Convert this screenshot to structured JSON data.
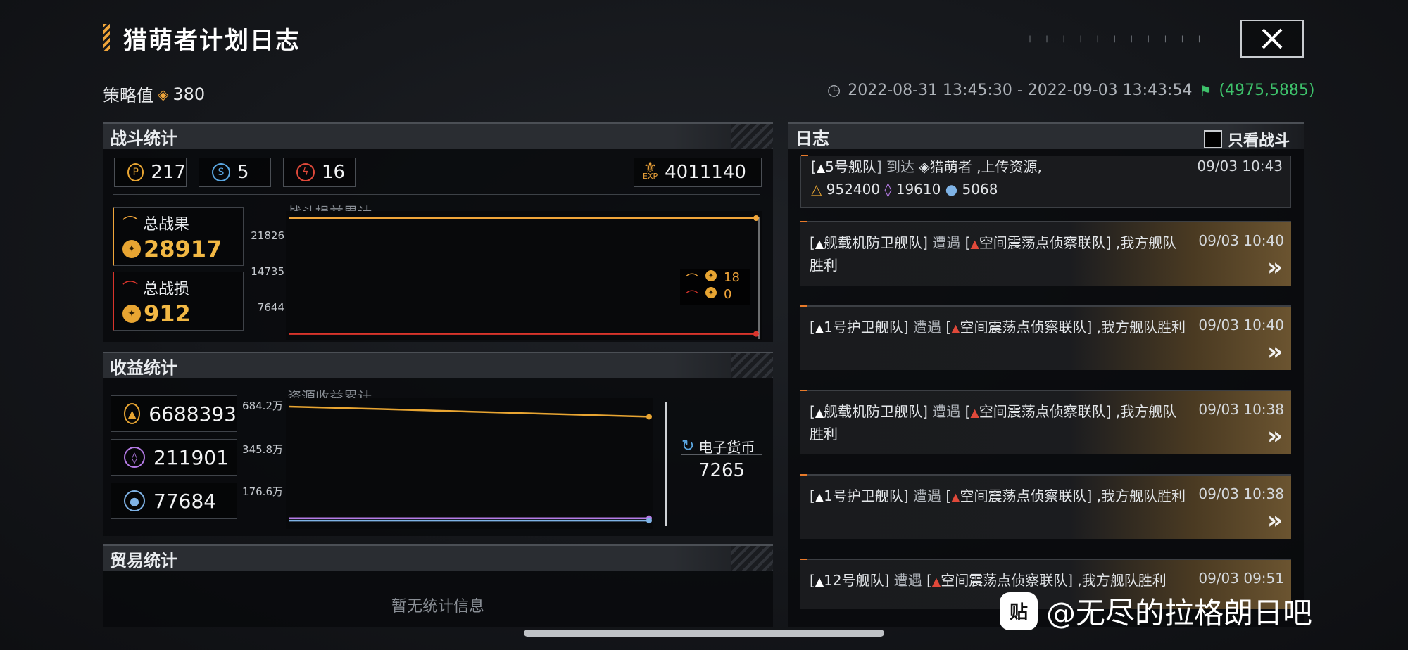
{
  "header": {
    "title": "猎萌者计划日志",
    "strategy_label": "策略值",
    "strategy_value": "380",
    "time_range": "2022-08-31 13:45:30 - 2022-09-03 13:43:54",
    "coordinates": "(4975,5885)",
    "ticks": "| | | | | |  | | | | |"
  },
  "combat": {
    "section_title": "战斗统计",
    "stats": [
      {
        "icon": "p-icon",
        "value": "217"
      },
      {
        "icon": "s-icon",
        "value": "5"
      },
      {
        "icon": "lightning-icon",
        "value": "16"
      }
    ],
    "exp_label": "EXP",
    "exp_value": "4011140",
    "total_gain_label": "总战果",
    "total_gain_value": "28917",
    "total_loss_label": "总战损",
    "total_loss_value": "912",
    "legend_gain": "18",
    "legend_loss": "0"
  },
  "income": {
    "section_title": "收益统计",
    "resources": [
      {
        "icon": "triangle-resource-icon",
        "value": "6688393",
        "color": "#e8a532"
      },
      {
        "icon": "crystal-resource-icon",
        "value": "211901",
        "color": "#b57be6"
      },
      {
        "icon": "orb-resource-icon",
        "value": "77684",
        "color": "#7fb3e6"
      }
    ],
    "currency_label": "电子货币",
    "currency_value": "7265"
  },
  "trade": {
    "section_title": "贸易统计",
    "empty_text": "暂无统计信息"
  },
  "log": {
    "section_title": "日志",
    "filter_label": "只看战斗",
    "entries": [
      {
        "a": "[",
        "fleet": "5号舰队",
        "b": "] 到达 ",
        "target": "猎萌者",
        "c": " ,上传资源,",
        "time": "09/03 10:43",
        "r1": "952400",
        "r2": "19610",
        "r3": "5068"
      },
      {
        "fleet": "舰载机防卫舰队",
        "verb": "遭遇",
        "enemy": "空间震荡点侦察联队",
        "result": ",我方舰队胜利",
        "time": "09/03 10:40"
      },
      {
        "fleet": "1号护卫舰队",
        "verb": "遭遇",
        "enemy": "空间震荡点侦察联队",
        "result": ",我方舰队胜利",
        "time": "09/03 10:40"
      },
      {
        "fleet": "舰载机防卫舰队",
        "verb": "遭遇",
        "enemy": "空间震荡点侦察联队",
        "result": ",我方舰队胜利",
        "time": "09/03 10:38"
      },
      {
        "fleet": "1号护卫舰队",
        "verb": "遭遇",
        "enemy": "空间震荡点侦察联队",
        "result": ",我方舰队胜利",
        "time": "09/03 10:38"
      },
      {
        "fleet": "12号舰队",
        "verb": "遭遇",
        "enemy": "空间震荡点侦察联队",
        "result": ",我方舰队胜利",
        "time": "09/03 09:51"
      }
    ]
  },
  "watermark": {
    "logo": "贴",
    "text": "@无尽的拉格朗日吧"
  },
  "chart_data": [
    {
      "type": "line",
      "title": "战斗损益累计",
      "y_ticks": [
        "21826",
        "14735",
        "7644"
      ],
      "ylim": [
        0,
        28917
      ],
      "series": [
        {
          "name": "总战果",
          "color": "#f0a53a",
          "values": [
            28917,
            28917,
            28917,
            28917,
            28917,
            28917,
            28917
          ]
        },
        {
          "name": "总战损",
          "color": "#d8342b",
          "values": [
            912,
            912,
            912,
            912,
            912,
            912,
            912
          ]
        }
      ]
    },
    {
      "type": "line",
      "title": "资源收益累计",
      "y_ticks": [
        "684.2万",
        "345.8万",
        "176.6万"
      ],
      "series": [
        {
          "color": "#e8a532",
          "values": [
            6688393,
            6550000,
            6400000,
            6250000,
            6100000
          ]
        },
        {
          "color": "#b57be6",
          "values": [
            211901,
            211901,
            211901,
            211901,
            211901
          ]
        },
        {
          "color": "#7fb3e6",
          "values": [
            77684,
            77684,
            77684,
            77684,
            77684
          ]
        }
      ]
    }
  ]
}
